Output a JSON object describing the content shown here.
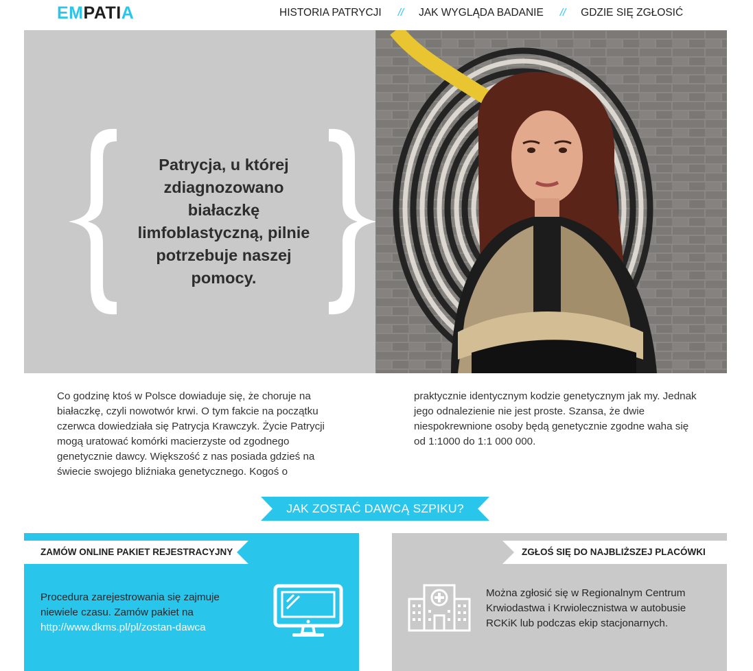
{
  "logo": {
    "part1": "EM",
    "part2": "PATI",
    "part3": "A"
  },
  "nav": {
    "items": [
      "HISTORIA PATRYCJI",
      "JAK WYGLĄDA BADANIE",
      "GDZIE SIĘ ZGŁOSIĆ"
    ],
    "separator": "//"
  },
  "hero": {
    "quote": "Patrycja, u której zdiagnozowano białaczkę limfoblastyczną, pilnie potrzebuje naszej pomocy.",
    "photo_icon": "portrait-photo"
  },
  "intro": {
    "col1": "Co godzinę ktoś w Polsce dowiaduje się, że choruje na białaczkę, czyli nowotwór krwi. O tym fakcie na początku czerwca dowiedziała się Patrycja Krawczyk. Życie Patrycji mogą uratować komórki macierzyste od zgodnego genetycznie dawcy. Większość z nas posiada gdzieś na świecie swojego bliźniaka genetycznego. Kogoś o",
    "col2": "praktycznie identycznym kodzie genetycznym jak my. Jednak jego odnalezienie nie jest proste. Szansa, że dwie niespokrewnione osoby będą genetycznie zgodne waha się od 1:1000 do 1:1 000 000."
  },
  "ribbon": {
    "label": "JAK ZOSTAĆ DAWCĄ SZPIKU?"
  },
  "cards": {
    "online": {
      "title": "ZAMÓW ONLINE PAKIET REJESTRACYJNY",
      "text": "Procedura zarejestrowania się zajmuje niewiele czasu. Zamów pakiet na",
      "link": "http://www.dkms.pl/pl/zostan-dawca",
      "icon": "monitor-icon"
    },
    "place": {
      "title": "ZGŁOŚ SIĘ DO NAJBLIŻSZEJ PLACÓWKI",
      "text": "Można zgłosić się w Regionalnym Centrum Krwiodastwa i Krwiolecznistwa w autobusie RCKiK lub podczas ekip stacjonarnych.",
      "icon": "hospital-icon"
    }
  },
  "colors": {
    "accent": "#29c5ea",
    "gray": "#c8c9c8",
    "dark": "#1f1f1f"
  }
}
